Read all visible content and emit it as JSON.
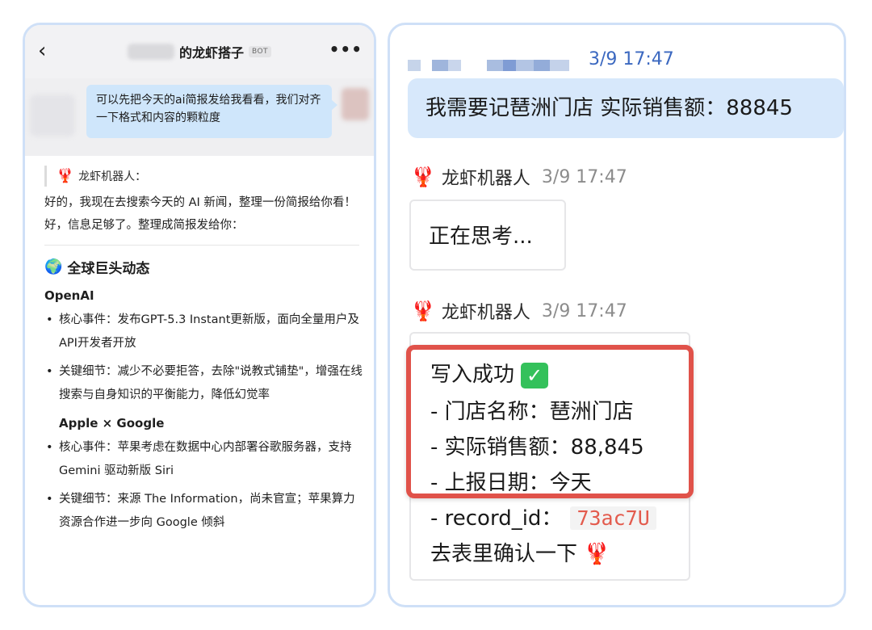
{
  "left": {
    "title": "的龙虾搭子",
    "badge": "BOT",
    "more": "•••",
    "user_message": "可以先把今天的ai简报发给我看看，我们对齐一下格式和内容的颗粒度",
    "bot_name": "龙虾机器人：",
    "reply_line1": "好的，我现在去搜索今天的 AI 新闻，整理一份简报给你看！",
    "reply_line2": "好，信息足够了。整理成简报发给你：",
    "section_title": "全球巨头动态",
    "company1": "OpenAI",
    "bullets1": [
      "核心事件：发布GPT-5.3 Instant更新版，面向全量用户及API开发者开放",
      "关键细节：减少不必要拒答，去除\"说教式铺垫\"，增强在线搜索与自身知识的平衡能力，降低幻觉率"
    ],
    "company2": "Apple × Google",
    "bullets2": [
      "核心事件：苹果考虑在数据中心内部署谷歌服务器，支持 Gemini 驱动新版 Siri",
      "关键细节：来源 The Information，尚未官宣；苹果算力资源合作进一步向 Google 倾斜"
    ]
  },
  "right": {
    "header_time": "3/9 17:47",
    "request": "我需要记琶洲门店 实际销售额：88845",
    "bot_name": "龙虾机器人",
    "bot_time1": "3/9 17:47",
    "thinking": "正在思考...",
    "bot_time2": "3/9 17:47",
    "result_title": "写入成功",
    "check": "✓",
    "line_store": "- 门店名称：琶洲门店",
    "line_sales": "- 实际销售额：88,845",
    "line_date": "- 上报日期：今天",
    "record_label": "- record_id：",
    "record_value": "73ac7U",
    "confirm": "去表里确认一下"
  },
  "colors": {
    "accent_blue": "#3b68c0",
    "highlight_red": "#e0524a",
    "bubble_blue": "#d7e8fb",
    "check_green": "#34c15b"
  }
}
